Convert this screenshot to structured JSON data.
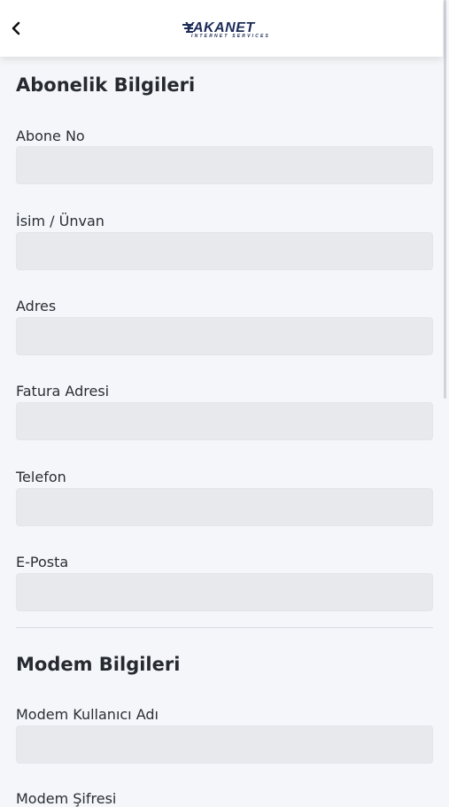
{
  "header": {
    "back_icon": "chevron-left-icon",
    "logo_text": "YAKANET",
    "logo_subtext": "INTERNET SERVICES",
    "logo_color": "#1c2c57"
  },
  "subscription": {
    "title": "Abonelik Bilgileri",
    "fields": [
      {
        "label": "Abone No",
        "value": ""
      },
      {
        "label": "İsim / Ünvan",
        "value": ""
      },
      {
        "label": "Adres",
        "value": ""
      },
      {
        "label": "Fatura Adresi",
        "value": ""
      },
      {
        "label": "Telefon",
        "value": ""
      },
      {
        "label": "E-Posta",
        "value": ""
      }
    ]
  },
  "modem": {
    "title": "Modem Bilgileri",
    "fields": [
      {
        "label": "Modem Kullanıcı Adı",
        "value": ""
      },
      {
        "label": "Modem Şifresi",
        "value": ""
      }
    ]
  },
  "colors": {
    "background": "#f4f6f9",
    "field_bg": "#e7e9ed",
    "text": "#262a30"
  }
}
